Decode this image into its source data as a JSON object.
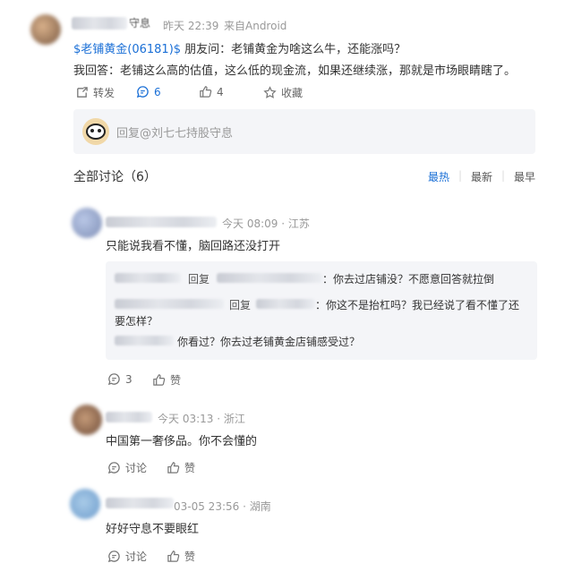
{
  "post": {
    "user_suffix": "守息",
    "time": "昨天 22:39",
    "source": "来自Android",
    "stock_tag": "$老铺黄金(06181)$",
    "line1_rest": " 朋友问：老铺黄金为啥这么牛，还能涨吗？",
    "line2": "我回答：老铺这么高的估值，这么低的现金流，如果还继续涨，那就是市场眼睛瞎了。",
    "actions": {
      "forward": "转发",
      "comments": "6",
      "likes": "4",
      "favorite": "收藏"
    }
  },
  "reply_input": {
    "placeholder": "回复@刘七七持股守息"
  },
  "discussion": {
    "title": "全部讨论（6）",
    "sort": [
      "最热",
      "最新",
      "最早"
    ]
  },
  "comments": [
    {
      "time_loc": "今天 08:09 · 江苏",
      "text": "只能说我看不懂，脑回路还没打开",
      "replies": [
        {
          "reply_word": "回复",
          "colon": "：",
          "text": "你去过店铺没？不愿意回答就拉倒"
        },
        {
          "reply_word": "回复",
          "colon": "：",
          "text": "你这不是抬杠吗？我已经说了看不懂了还",
          "text2": "要怎样？"
        },
        {
          "text": "你看过？你去过老铺黄金店铺感受过？"
        }
      ],
      "reply_count": "3",
      "like": "赞"
    },
    {
      "time_loc": "今天 03:13 · 浙江",
      "text": "中国第一奢侈品。你不会懂的",
      "discuss": "讨论",
      "like": "赞"
    },
    {
      "time_loc": "03-05 23:56 · 湖南",
      "text": "好好守息不要眼红",
      "discuss": "讨论",
      "like": "赞"
    }
  ],
  "colors": {
    "link": "#1a6fd6",
    "muted": "#999999",
    "reply_bg": "#f4f5f8"
  }
}
